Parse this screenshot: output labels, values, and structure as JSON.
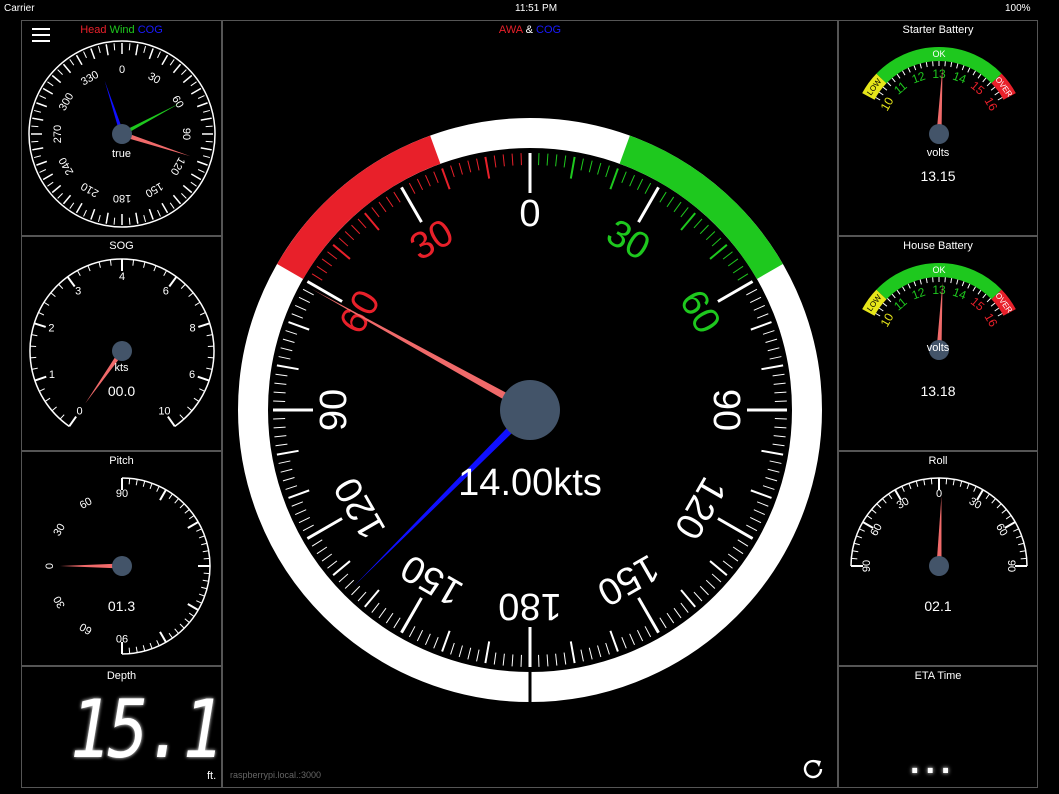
{
  "statusbar": {
    "carrier": "Carrier",
    "time": "11:51 PM",
    "battery": "100%"
  },
  "colors": {
    "red": "#e8202a",
    "green": "#1ec81e",
    "blue": "#1010ff",
    "needle": "#f06a6a",
    "hub": "#435469",
    "yellow": "#e6e61a"
  },
  "compass": {
    "legend_head": "Head",
    "legend_wind": "Wind",
    "legend_cog": "COG",
    "center_label": "true",
    "labels": [
      "0",
      "30",
      "60",
      "90",
      "120",
      "150",
      "180",
      "210",
      "240",
      "270",
      "300",
      "330"
    ]
  },
  "sog": {
    "title": "SOG",
    "unit": "kts",
    "value": "00.0",
    "labels": [
      "0",
      "1",
      "2",
      "3",
      "4",
      "6",
      "8",
      "6",
      "10"
    ]
  },
  "pitch": {
    "title": "Pitch",
    "value": "01.3",
    "labels": [
      "90",
      "60",
      "30",
      "0",
      "30",
      "60",
      "90"
    ]
  },
  "depth": {
    "title": "Depth",
    "value": "15.1",
    "unit": "ft."
  },
  "main": {
    "legend_awa": "AWA",
    "legend_amp": "&",
    "legend_cog": "COG",
    "speed": "14.00kts",
    "labels": [
      "0",
      "30",
      "60",
      "90",
      "120",
      "150",
      "180",
      "150",
      "120",
      "90",
      "60",
      "30"
    ],
    "host": "raspberrypi.local.:3000"
  },
  "starter": {
    "title": "Starter Battery",
    "unit": "volts",
    "value": "13.15",
    "ok": "OK",
    "low": "LOW",
    "over": "OVER",
    "labels": [
      "10",
      "11",
      "12",
      "13",
      "14",
      "15",
      "16"
    ]
  },
  "house": {
    "title": "House Battery",
    "unit": "volts",
    "value": "13.18",
    "ok": "OK",
    "low": "LOW",
    "over": "OVER",
    "labels": [
      "10",
      "11",
      "12",
      "13",
      "14",
      "15",
      "16"
    ]
  },
  "roll": {
    "title": "Roll",
    "value": "02.1",
    "labels": [
      "90",
      "60",
      "30",
      "0",
      "30",
      "60",
      "90"
    ]
  },
  "eta": {
    "title": "ETA Time",
    "value": "..."
  }
}
